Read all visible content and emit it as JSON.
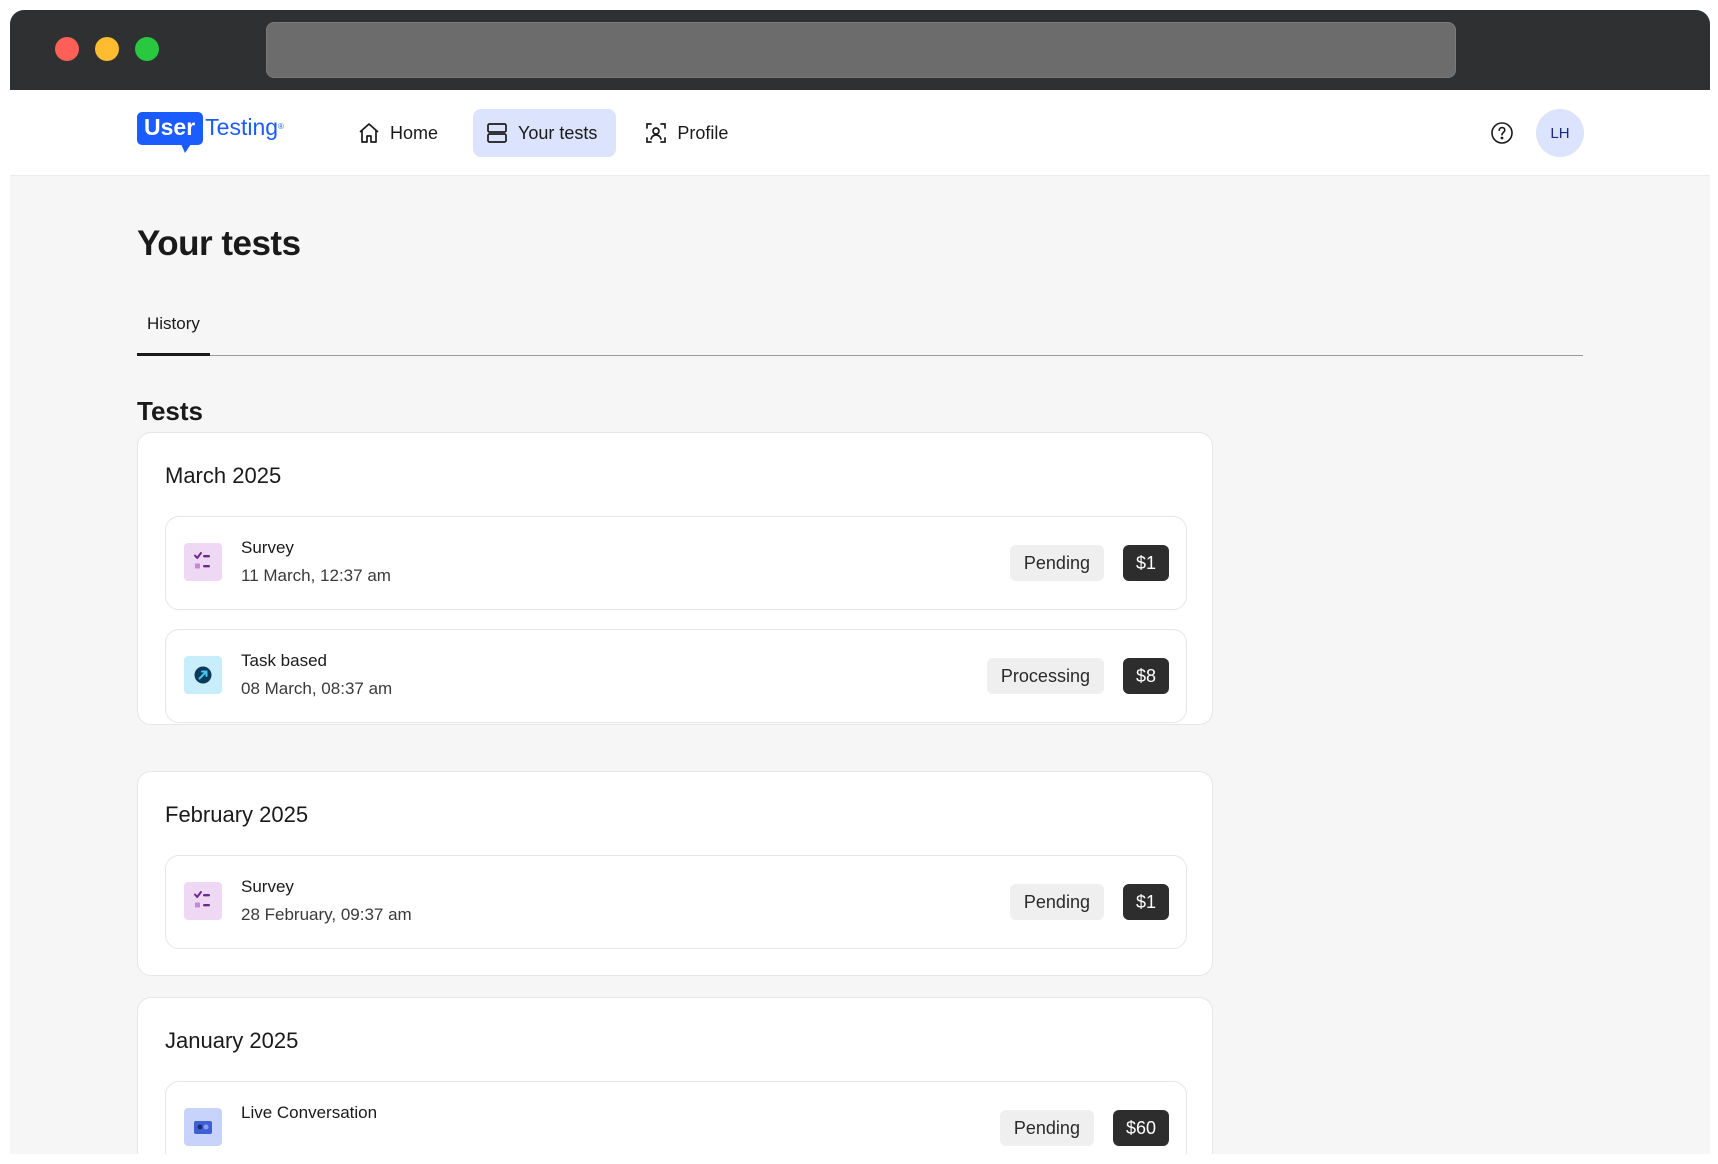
{
  "logo": {
    "part1": "User",
    "part2": "Testing"
  },
  "nav": {
    "home": "Home",
    "your_tests": "Your tests",
    "profile": "Profile"
  },
  "avatar": {
    "initials": "LH"
  },
  "page": {
    "title": "Your tests",
    "tab": "History",
    "section_title": "Tests"
  },
  "months": [
    {
      "title": "March 2025",
      "tests": [
        {
          "name": "Survey",
          "date": "11 March, 12:37 am",
          "status": "Pending",
          "price": "$1",
          "icon": "survey-icon"
        },
        {
          "name": "Task based",
          "date": "08 March, 08:37 am",
          "status": "Processing",
          "price": "$8",
          "icon": "task-icon"
        }
      ]
    },
    {
      "title": "February 2025",
      "tests": [
        {
          "name": "Survey",
          "date": "28 February, 09:37 am",
          "status": "Pending",
          "price": "$1",
          "icon": "survey-icon"
        }
      ]
    },
    {
      "title": "January 2025",
      "tests": [
        {
          "name": "Live Conversation",
          "date": "",
          "status": "Pending",
          "price": "$60",
          "icon": "live-conversation-icon"
        }
      ]
    }
  ],
  "colors": {
    "brand": "#1a5cff",
    "nav_active": "#dbe4fc",
    "price_badge": "#2d2d2d",
    "status_badge": "#efefef"
  }
}
